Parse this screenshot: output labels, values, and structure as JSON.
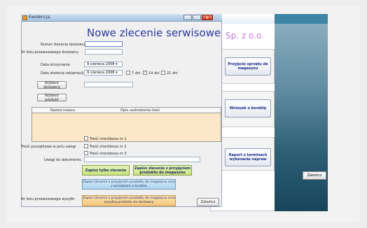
{
  "window": {
    "title": "Ewidencja",
    "heading": "Nowe zlecenie serwisowe",
    "close_glyph": "x"
  },
  "form": {
    "numer_zlecenia_label": "Numer zlecenia dostawcy",
    "nr_listu_label": "Nr listu przewozowego dostawcy",
    "data_otrzymania_label": "Data otrzymania",
    "data_otrzymania_value": "9   czerwca   2008  ▾",
    "data_zlozenia_label": "Data złożenia reklamacji",
    "data_zlozenia_value": "9   czerwca   2008  ▾",
    "options": [
      {
        "label": "7 dni",
        "checked": false
      },
      {
        "label": "14 dni",
        "checked": true
      },
      {
        "label": "21 dni",
        "checked": false
      }
    ],
    "wybierz_dostawce": "Wybierz dostawcę",
    "wybierz_produkt": "Wybierz produkt",
    "checkboxes": [
      "Treść checkboxa nr 1",
      "Treść checkboxa nr 2",
      "Treść checkboxa nr 3"
    ],
    "tresc_label": "Treść początkowa w polu uwagi",
    "uwagi_label": "Uwagi do dokumentu",
    "nr_listu_wysylki_label": "Nr listu przewozowego wysyłki"
  },
  "grid": {
    "headers": [
      "Nazwa towaru",
      "Opis uszkodzenia",
      "Ilość"
    ]
  },
  "actions": {
    "zapisz_tylko": "Zapisz tylko zlecenie",
    "zapisz_przyjeciem": "Zapisz zlecenie z przyjęciem produktu do magazynu",
    "zapisz_wnioskiem": "Zapisz zlecenie z przyjęciem produktu do magazynu oraz z wnioskiem o korektę",
    "zapisz_wysylka": "Zapisz zlecenie z przyjęciem produktu do magazynu oraz wysyłką produktu do dostawcy",
    "zakoncz": "Zakończ"
  },
  "background_app": {
    "company": "Sp. z o.o.",
    "btn_przyjecie": "Przyjęcie sprzętu do magazynu",
    "btn_wniosek": "Wniosek o korektę",
    "btn_raport": "Raport o terminach wykonania napraw",
    "zakoncz": "Zakończ"
  }
}
